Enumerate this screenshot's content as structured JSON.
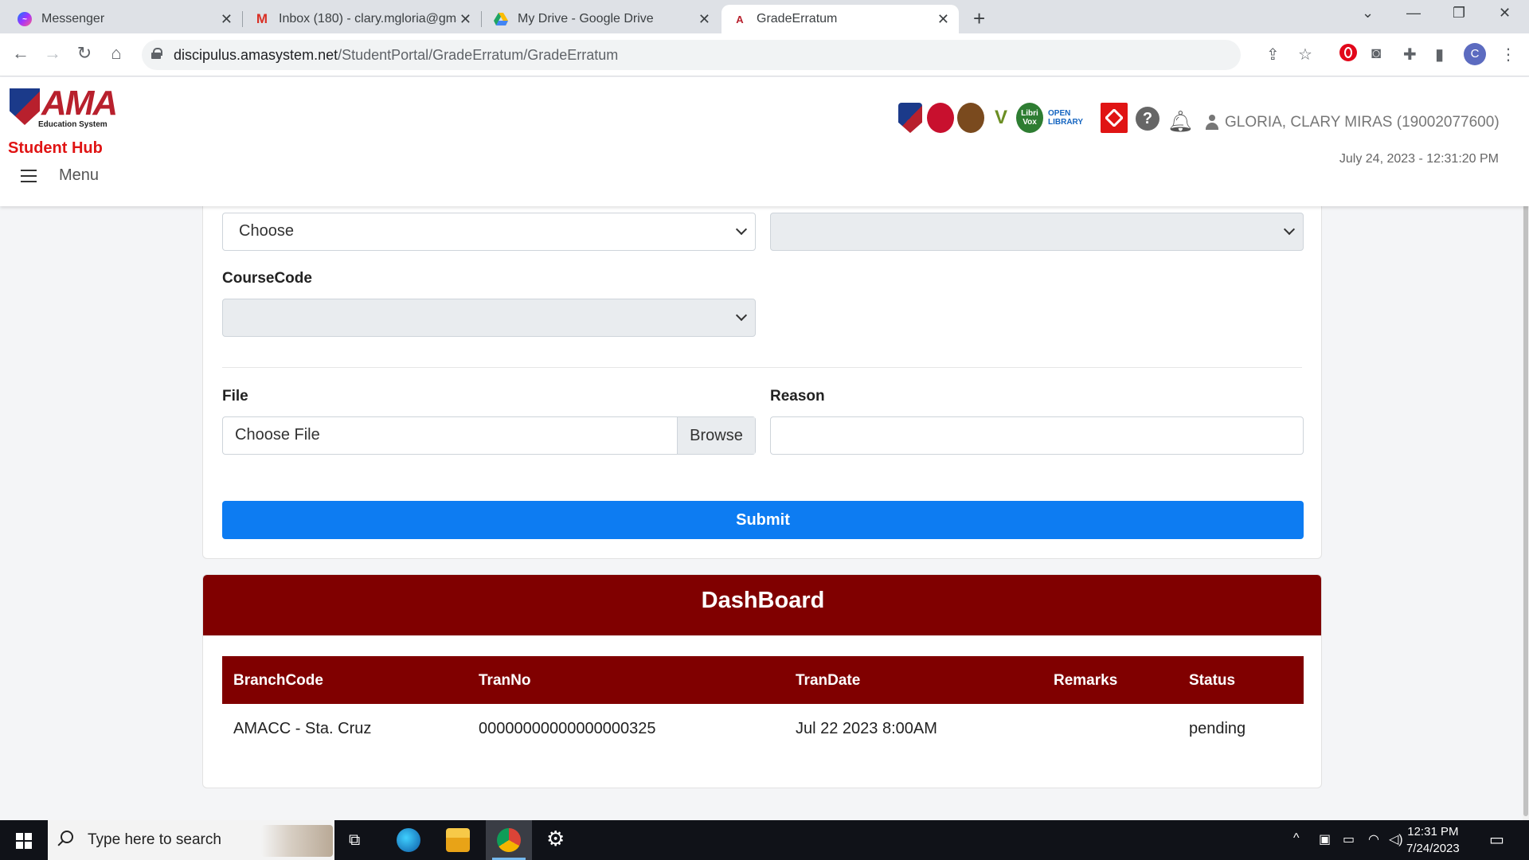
{
  "browser": {
    "tabs": [
      {
        "title": "Messenger",
        "icon": "messenger-icon"
      },
      {
        "title": "Inbox (180) - clary.mgloria@gma",
        "icon": "gmail-icon"
      },
      {
        "title": "My Drive - Google Drive",
        "icon": "google-drive-icon"
      },
      {
        "title": "GradeErratum",
        "icon": "ama-favicon"
      }
    ],
    "url_host": "discipulus.amasystem.net",
    "url_path": "/StudentPortal/GradeErratum/GradeErratum",
    "profile_initial": "C"
  },
  "header": {
    "logo_text": "AMA",
    "logo_sub": "Education System",
    "app_name": "Student Hub",
    "menu_label": "Menu",
    "partner_links": [
      "ama-shield-icon",
      "library-seal-icon",
      "emblem-icon",
      "v-logo-icon",
      "Libri Vox",
      "OPEN LIBRARY",
      "diamond-logo-icon"
    ],
    "help_glyph": "?",
    "user_name": "GLORIA, CLARY MIRAS (19002077600)",
    "datetime": "July 24, 2023 - 12:31:20 PM"
  },
  "form": {
    "select_left_value": "Choose",
    "select_right_value": "",
    "coursecode_label": "CourseCode",
    "coursecode_value": "",
    "file_label": "File",
    "file_placeholder": "Choose File",
    "browse_label": "Browse",
    "reason_label": "Reason",
    "reason_value": "",
    "submit_label": "Submit"
  },
  "dashboard": {
    "title": "DashBoard",
    "columns": [
      "BranchCode",
      "TranNo",
      "TranDate",
      "Remarks",
      "Status"
    ],
    "rows": [
      {
        "BranchCode": "AMACC - Sta. Cruz",
        "TranNo": "00000000000000000325",
        "TranDate": "Jul 22 2023 8:00AM",
        "Remarks": "",
        "Status": "pending"
      }
    ]
  },
  "taskbar": {
    "search_placeholder": "Type here to search",
    "time": "12:31 PM",
    "date": "7/24/2023"
  },
  "colors": {
    "maroon": "#800000",
    "submit_blue": "#0d7cf2",
    "hub_red": "#e01414"
  }
}
